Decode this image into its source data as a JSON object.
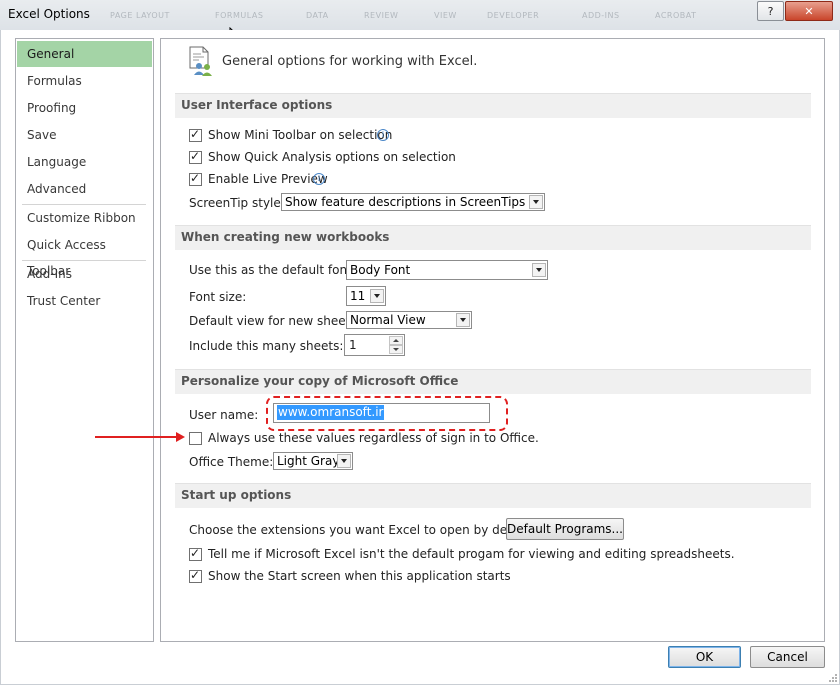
{
  "window": {
    "title": "Excel Options",
    "help_label": "?",
    "close_label": "✕",
    "ribbon_ghost_tabs": [
      "PAGE LAYOUT",
      "FORMULAS",
      "DATA",
      "REVIEW",
      "VIEW",
      "DEVELOPER",
      "ADD-INS",
      "ACROBAT"
    ]
  },
  "nav": {
    "items": [
      {
        "label": "General",
        "active": true
      },
      {
        "label": "Formulas"
      },
      {
        "label": "Proofing"
      },
      {
        "label": "Save"
      },
      {
        "label": "Language"
      },
      {
        "label": "Advanced"
      },
      {
        "label": "Customize Ribbon"
      },
      {
        "label": "Quick Access Toolbar"
      },
      {
        "label": "Add-Ins"
      },
      {
        "label": "Trust Center"
      }
    ]
  },
  "header": {
    "text": "General options for working with Excel.",
    "icon": "options-people-icon"
  },
  "ui_options": {
    "section_title": "User Interface options",
    "mini_toolbar": {
      "label": "Show Mini Toolbar on selection",
      "checked": true
    },
    "quick_analysis": {
      "label": "Show Quick Analysis options on selection",
      "checked": true
    },
    "live_preview": {
      "label": "Enable Live Preview",
      "checked": true
    },
    "screentip_label": "ScreenTip style:",
    "screentip_value": "Show feature descriptions in ScreenTips"
  },
  "new_workbooks": {
    "section_title": "When creating new workbooks",
    "font_label": "Use this as the default font:",
    "font_value": "Body Font",
    "size_label": "Font size:",
    "size_value": "11",
    "view_label": "Default view for new sheets:",
    "view_value": "Normal View",
    "sheets_label": "Include this many sheets:",
    "sheets_value": "1"
  },
  "personalize": {
    "section_title": "Personalize your copy of Microsoft Office",
    "username_label": "User name:",
    "username_value": "www.omransoft.ir",
    "always_use": {
      "label": "Always use these values regardless of sign in to Office.",
      "checked": false
    },
    "theme_label": "Office Theme:",
    "theme_value": "Light Gray"
  },
  "startup": {
    "section_title": "Start up options",
    "extensions_label": "Choose the extensions you want Excel to open by default:",
    "default_programs_button": "Default Programs...",
    "tell_me": {
      "label": "Tell me if Microsoft Excel isn't the default progam for viewing and editing spreadsheets.",
      "checked": true
    },
    "start_screen": {
      "label": "Show the Start screen when this application starts",
      "checked": true
    }
  },
  "footer": {
    "ok_label": "OK",
    "cancel_label": "Cancel"
  },
  "colors": {
    "nav_active": "#a4d4a6",
    "annotation_red": "#e02020",
    "selection_blue": "#3399ff"
  }
}
